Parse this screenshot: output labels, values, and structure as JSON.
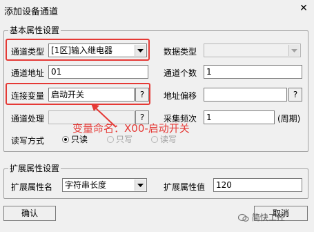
{
  "window": {
    "title": "添加设备通道",
    "close_glyph": "✕"
  },
  "basic": {
    "group_label": "基本属性设置",
    "channel_type_label": "通道类型",
    "channel_type_value": "[1区]输入继电器",
    "data_type_label": "数据类型",
    "data_type_value": "",
    "channel_addr_label": "通道地址",
    "channel_addr_value": "01",
    "channel_count_label": "通道个数",
    "channel_count_value": "1",
    "connect_var_label": "连接变量",
    "connect_var_value": "启动开关",
    "addr_offset_label": "地址偏移",
    "addr_offset_value": "",
    "channel_proc_label": "通道处理",
    "channel_proc_value": "",
    "sample_freq_label": "采集频次",
    "sample_freq_value": "1",
    "period_label": "(周期)",
    "rw_label": "读写方式",
    "rw_options": [
      "只读",
      "只写",
      "读写"
    ],
    "question": "?"
  },
  "extended": {
    "group_label": "扩展属性设置",
    "ext_name_label": "扩展属性名",
    "ext_name_value": "字符串长度",
    "ext_value_label": "扩展属性值",
    "ext_value_value": "120"
  },
  "annotation": {
    "text": "变量命名：X00-启动开关",
    "color": "#e53935"
  },
  "buttons": {
    "confirm": "确认",
    "cancel": "取消"
  },
  "watermark": {
    "text": "简快工控",
    "icon": "wechat-icon"
  }
}
